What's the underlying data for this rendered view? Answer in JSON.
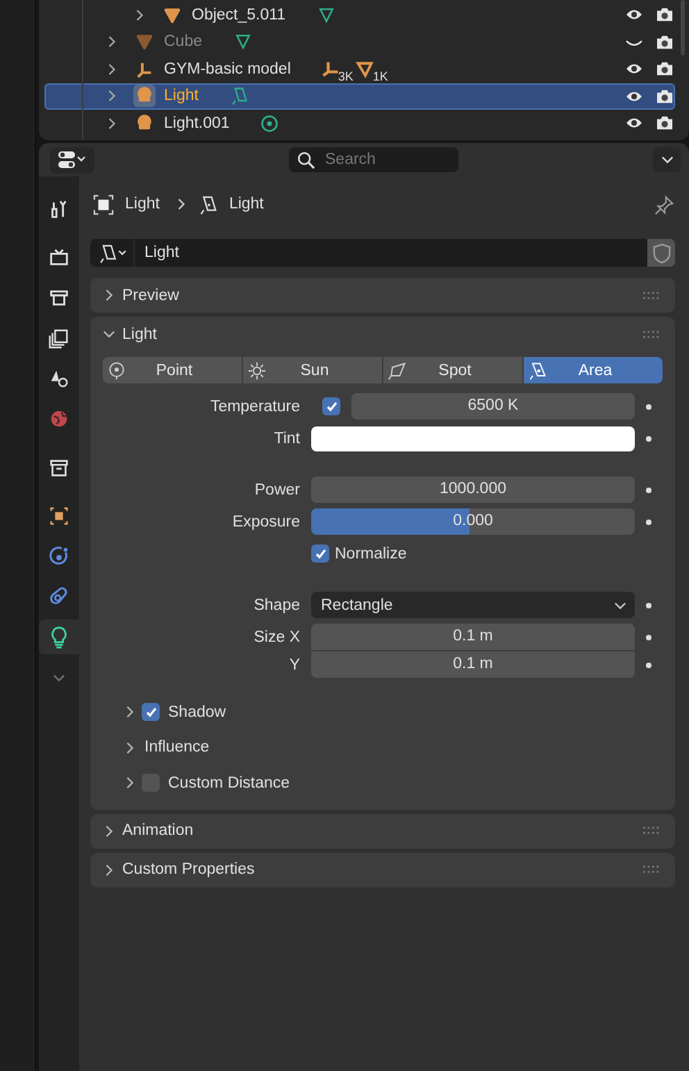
{
  "outliner": {
    "rows": [
      {
        "name": "Object_5.011",
        "kind": "mesh",
        "data": [
          {
            "kind": "mesh"
          }
        ],
        "depth_child": true,
        "selected": false,
        "visible": true
      },
      {
        "name": "Cube",
        "kind": "mesh",
        "data": [
          {
            "kind": "mesh"
          }
        ],
        "depth_child": false,
        "selected": false,
        "visible": false
      },
      {
        "name": "GYM-basic model",
        "kind": "empty",
        "data": [
          {
            "kind": "empty",
            "count": "3K"
          },
          {
            "kind": "mesh",
            "count": "1K"
          }
        ],
        "depth_child": false,
        "selected": false,
        "visible": true
      },
      {
        "name": "Light",
        "kind": "light",
        "data": [
          {
            "kind": "area"
          }
        ],
        "depth_child": false,
        "selected": true,
        "visible": true
      },
      {
        "name": "Light.001",
        "kind": "light",
        "data": [
          {
            "kind": "point"
          }
        ],
        "depth_child": false,
        "selected": false,
        "visible": true
      }
    ]
  },
  "properties": {
    "search": {
      "placeholder": "Search"
    },
    "tabs": [
      {
        "kind": "tool",
        "selected": false
      },
      {
        "kind": "render",
        "selected": false
      },
      {
        "kind": "output",
        "selected": false
      },
      {
        "kind": "view_layer",
        "selected": false
      },
      {
        "kind": "scene",
        "selected": false
      },
      {
        "kind": "world",
        "selected": false
      },
      {
        "kind": "collection",
        "selected": false
      },
      {
        "kind": "object",
        "selected": false
      },
      {
        "kind": "physics",
        "selected": false
      },
      {
        "kind": "constraints",
        "selected": false
      },
      {
        "kind": "data",
        "selected": true
      }
    ],
    "breadcrumb": [
      "Light",
      "Light"
    ],
    "datablock": {
      "value": "Light"
    },
    "panels": [
      {
        "title": "Preview",
        "expanded": false
      },
      {
        "title": "Light",
        "expanded": true,
        "light_types": [
          {
            "label": "Point",
            "kind": "point",
            "selected": false
          },
          {
            "label": "Sun",
            "kind": "sun",
            "selected": false
          },
          {
            "label": "Spot",
            "kind": "spot",
            "selected": false
          },
          {
            "label": "Area",
            "kind": "area",
            "selected": true
          }
        ],
        "temperature": {
          "label": "Temperature",
          "checked": true,
          "value": "6500 K"
        },
        "tint": {
          "label": "Tint",
          "color": "#ffffff"
        },
        "power": {
          "label": "Power",
          "value": "1000.000"
        },
        "exposure": {
          "label": "Exposure",
          "value": "0.000",
          "level": 0.49
        },
        "normalize": {
          "label": "Normalize",
          "checked": true
        },
        "shape": {
          "label": "Shape",
          "value": "Rectangle"
        },
        "size_x": {
          "label": "Size X",
          "value": "0.1 m"
        },
        "size_y": {
          "label": "Y",
          "value": "0.1 m"
        },
        "subpanels": [
          {
            "label": "Shadow",
            "kind": "checkbox",
            "checked": true
          },
          {
            "label": "Influence",
            "kind": "plain"
          },
          {
            "label": "Custom Distance",
            "kind": "checkbox",
            "checked": false
          }
        ]
      },
      {
        "title": "Animation",
        "expanded": false
      },
      {
        "title": "Custom Properties",
        "expanded": false
      }
    ]
  }
}
